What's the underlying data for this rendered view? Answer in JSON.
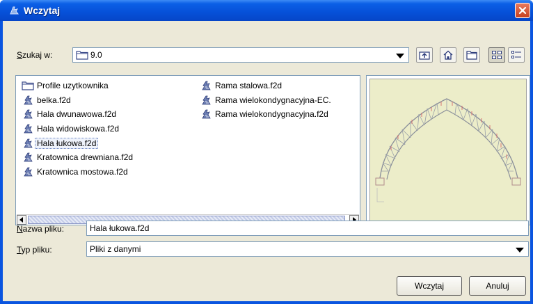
{
  "window": {
    "title": "Wczytaj"
  },
  "lookin": {
    "label_first": "S",
    "label_rest": "zukaj w:",
    "value": "9.0"
  },
  "toolbar": {
    "icons": [
      "up-folder-icon",
      "home-icon",
      "new-folder-icon",
      "list-view-icon",
      "details-view-icon"
    ]
  },
  "files": {
    "column1": [
      {
        "name": "Profile uzytkownika",
        "icon": "folder-icon"
      },
      {
        "name": "belka.f2d",
        "icon": "f2d-file-icon"
      },
      {
        "name": "Hala dwunawowa.f2d",
        "icon": "f2d-file-icon"
      },
      {
        "name": "Hala widowiskowa.f2d",
        "icon": "f2d-file-icon"
      },
      {
        "name": "Hala łukowa.f2d",
        "icon": "f2d-file-icon"
      },
      {
        "name": "Kratownica drewniana.f2d",
        "icon": "f2d-file-icon"
      },
      {
        "name": "Kratownica mostowa.f2d",
        "icon": "f2d-file-icon"
      }
    ],
    "column2": [
      {
        "name": "Rama stalowa.f2d",
        "icon": "f2d-file-icon"
      },
      {
        "name": "Rama wielokondygnacyjna-EC.",
        "icon": "f2d-file-icon"
      },
      {
        "name": "Rama wielokondygnacyjna.f2d",
        "icon": "f2d-file-icon"
      }
    ],
    "selected": "Hala łukowa.f2d"
  },
  "filename": {
    "label_first": "N",
    "label_rest": "azwa pliku:",
    "value": "Hala łukowa.f2d"
  },
  "filetype": {
    "label_first": "T",
    "label_rest": "yp pliku:",
    "value": "Pliki z danymi"
  },
  "buttons": {
    "open": "Wczytaj",
    "cancel": "Anuluj"
  },
  "colors": {
    "titlebar": "#0650d8",
    "dialog_bg": "#ece9d8",
    "preview_bg": "#ecedc9",
    "close": "#d4512e"
  }
}
